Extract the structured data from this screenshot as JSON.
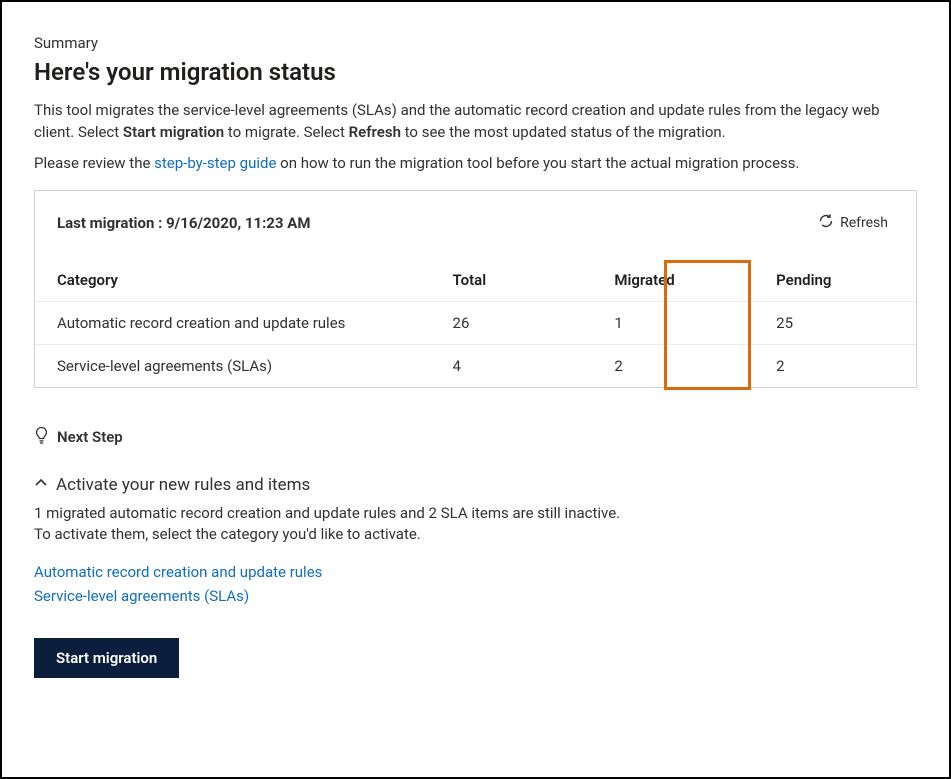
{
  "summaryLabel": "Summary",
  "pageTitle": "Here's your migration status",
  "description": {
    "pre": "This tool migrates the service-level agreements (SLAs) and the automatic record creation and update rules from the legacy web client. Select ",
    "bold1": "Start migration",
    "mid": " to migrate. Select ",
    "bold2": "Refresh",
    "post": " to see the most updated status of the migration."
  },
  "guide": {
    "pre": "Please review the ",
    "linkText": "step-by-step guide",
    "post": " on how to run the migration tool before you start the actual migration process."
  },
  "lastMigrationLabel": "Last migration : 9/16/2020, 11:23 AM",
  "refreshLabel": "Refresh",
  "table": {
    "headers": {
      "category": "Category",
      "total": "Total",
      "migrated": "Migrated",
      "pending": "Pending"
    },
    "rows": [
      {
        "category": "Automatic record creation and update rules",
        "total": "26",
        "migrated": "1",
        "pending": "25"
      },
      {
        "category": "Service-level agreements (SLAs)",
        "total": "4",
        "migrated": "2",
        "pending": "2"
      }
    ]
  },
  "nextStepLabel": "Next Step",
  "accordion": {
    "title": "Activate your new rules and items",
    "line1": "1 migrated automatic record creation and update rules and 2 SLA items are still inactive.",
    "line2": "To activate them, select the category you'd like to activate."
  },
  "categoryLinks": {
    "arc": "Automatic record creation and update rules",
    "sla": "Service-level agreements (SLAs)"
  },
  "startMigrationLabel": "Start migration"
}
